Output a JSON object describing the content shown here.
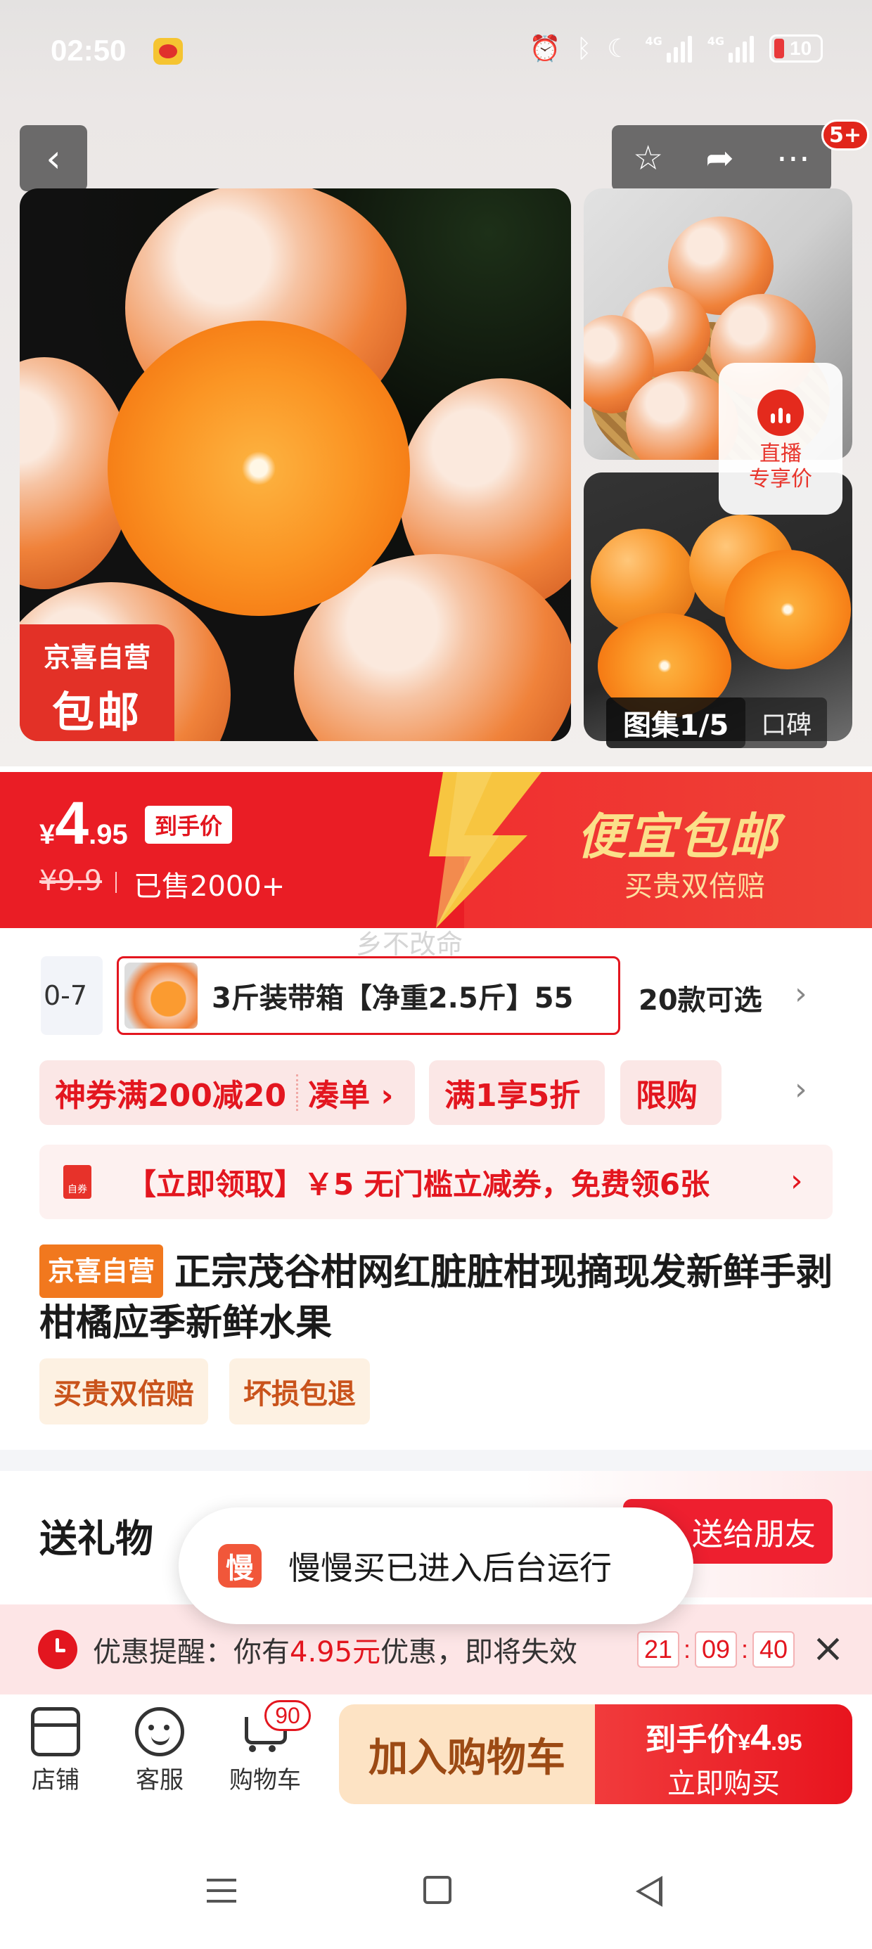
{
  "status_bar": {
    "time": "02:50",
    "network_1": "4G",
    "network_2": "4G",
    "battery": "10"
  },
  "nav": {
    "badge": "5+"
  },
  "gallery": {
    "badge_line1": "京喜自营",
    "badge_line2": "包邮",
    "live_label_line1": "直播",
    "live_label_line2": "专享价",
    "counter": "图集1/5",
    "review_label": "口碑"
  },
  "price": {
    "currency": "¥",
    "integer": "4",
    "decimal": ".95",
    "tag": "到手价",
    "original": "¥9.9",
    "sold": "已售2000+",
    "slogan": "便宜包邮",
    "sub_slogan": "买贵双倍赔"
  },
  "watermark": "乡不改命",
  "sku": {
    "previous_partial": "0-7",
    "selected": "3斤装带箱【净重2.5斤】55",
    "more": "20款可选"
  },
  "coupons": [
    {
      "label": "神券满200减20",
      "action": "凑单 ›"
    },
    {
      "label": "满1享5折"
    },
    {
      "label": "限购"
    }
  ],
  "voucher": {
    "icon_text": "自券",
    "text": "【立即领取】￥5 无门槛立减券，免费领6张"
  },
  "product": {
    "store_tag": "京喜自营",
    "title": "正宗茂谷柑网红脏脏柑现摘现发新鲜手剥柑橘应季新鲜水果",
    "guarantees": [
      "买贵双倍赔",
      "坏损包退"
    ]
  },
  "gift": {
    "title": "送礼物",
    "button": "送给朋友"
  },
  "toast": {
    "icon_text": "慢",
    "text": "慢慢买已进入后台运行"
  },
  "reminder": {
    "prefix": "优惠提醒：你有",
    "amount": "4.95元",
    "suffix": "优惠，即将失效",
    "hours": "21",
    "minutes": "09",
    "seconds": "40"
  },
  "action_bar": {
    "store": "店铺",
    "service": "客服",
    "cart": "购物车",
    "cart_count": "90",
    "add_to_cart": "加入购物车",
    "buy_prefix": "到手价",
    "buy_currency": "¥",
    "buy_int": "4",
    "buy_dec": ".95",
    "buy_now": "立即购买"
  }
}
